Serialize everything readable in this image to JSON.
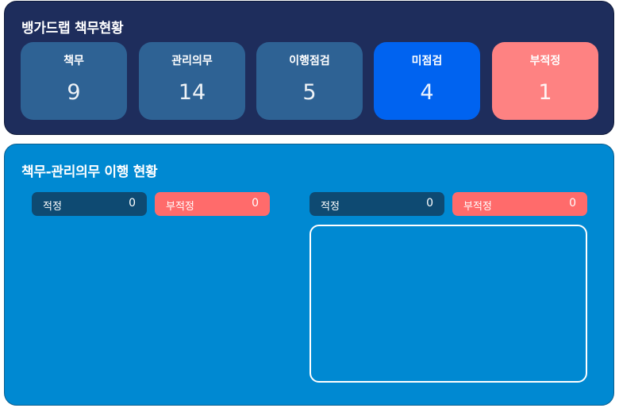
{
  "summary": {
    "title": "뱅가드랩 책무현황",
    "cards": [
      {
        "label": "책무",
        "value": "9",
        "color": "#2e6294"
      },
      {
        "label": "관리의무",
        "value": "14",
        "color": "#2e6294"
      },
      {
        "label": "이행점검",
        "value": "5",
        "color": "#2e6294"
      },
      {
        "label": "미점검",
        "value": "4",
        "color": "#0063f0"
      },
      {
        "label": "부적정",
        "value": "1",
        "color": "#fe8282"
      }
    ]
  },
  "compliance": {
    "title": "책무-관리의무 이행 현황",
    "left": {
      "ok_label": "적정",
      "ok_count": "0",
      "bad_label": "부적정",
      "bad_count": "0"
    },
    "right": {
      "ok_label": "적정",
      "ok_count": "0",
      "bad_label": "부적정",
      "bad_count": "0"
    }
  },
  "colors": {
    "navy_panel": "#1e2d5c",
    "blue_panel": "#0089d2",
    "ok_pill": "#0e4a72",
    "bad_pill": "#ff6b6b"
  }
}
